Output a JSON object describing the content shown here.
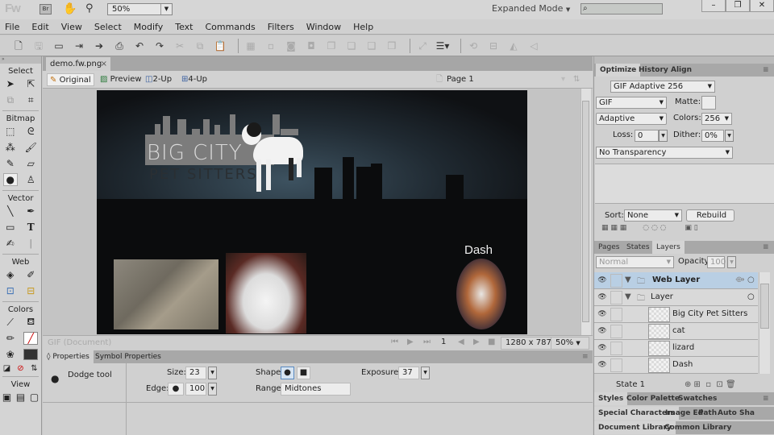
{
  "app": {
    "logo": "Fw",
    "bridge_label": "Br",
    "zoom_value": "50%",
    "workspace_mode": "Expanded Mode",
    "search_placeholder": "",
    "window_controls": {
      "minimize": "–",
      "restore": "❐",
      "close": "✕"
    }
  },
  "menu": [
    "File",
    "Edit",
    "View",
    "Select",
    "Modify",
    "Text",
    "Commands",
    "Filters",
    "Window",
    "Help"
  ],
  "toolbar": {
    "icons": [
      "new-document-icon",
      "save-icon",
      "open-icon",
      "import-icon",
      "export-icon",
      "print-icon",
      "undo-icon",
      "redo-icon",
      "cut-icon",
      "copy-icon",
      "paste-icon",
      "group-icon",
      "ungroup-icon",
      "join-icon",
      "split-icon",
      "bring-to-front-icon",
      "bring-forward-icon",
      "send-backward-icon",
      "send-to-back-icon",
      "distribute-icon",
      "align-icon",
      "rotate-icon",
      "flip-icon",
      "flip-horizontal-icon",
      "flip-vertical-icon"
    ]
  },
  "tools": {
    "sections": {
      "select": "Select",
      "bitmap": "Bitmap",
      "vector": "Vector",
      "web": "Web",
      "colors": "Colors",
      "view": "View"
    },
    "active_tool": "Dodge tool"
  },
  "document": {
    "tab_name": "demo.fw.png",
    "tab_close": "×",
    "views": [
      "Original",
      "Preview",
      "2-Up",
      "4-Up"
    ],
    "active_view": "Original",
    "page": "Page 1"
  },
  "artwork": {
    "logo_line1": "BIG CITY",
    "logo_line2": "PET SITTERS",
    "pet_label": "Dash",
    "images": [
      "lizard",
      "cat",
      "dog"
    ]
  },
  "status": {
    "doc_type": "GIF (Document)",
    "frame": "1",
    "dimensions": "1280 x 787",
    "zoom": "50%"
  },
  "properties": {
    "tabs": [
      "Properties",
      "Symbol Properties"
    ],
    "tool_name": "Dodge tool",
    "size_label": "Size:",
    "size_value": "23",
    "edge_label": "Edge:",
    "edge_value": "100",
    "shape_label": "Shape:",
    "range_label": "Range:",
    "range_value": "Midtones",
    "exposure_label": "Exposure:",
    "exposure_value": "37"
  },
  "optimize": {
    "tabs": [
      "Optimize",
      "History",
      "Align"
    ],
    "preset": "GIF Adaptive 256",
    "format": "GIF",
    "matte_label": "Matte:",
    "palette": "Adaptive",
    "colors_label": "Colors:",
    "colors_value": "256",
    "loss_label": "Loss:",
    "loss_value": "0",
    "dither_label": "Dither:",
    "dither_value": "0%",
    "transparency": "No Transparency",
    "sort_label": "Sort:",
    "sort_value": "None",
    "rebuild_label": "Rebuild"
  },
  "layers": {
    "tabs": [
      "Pages",
      "States",
      "Layers"
    ],
    "blend_mode": "Normal",
    "opacity_label": "Opacity",
    "opacity_value": "100",
    "rows": [
      {
        "name": "Web Layer",
        "type": "folder",
        "selected": true
      },
      {
        "name": "Layer",
        "type": "folder",
        "selected": false
      },
      {
        "name": "Big City Pet Sitters ...",
        "type": "object",
        "selected": false
      },
      {
        "name": "cat",
        "type": "object",
        "selected": false
      },
      {
        "name": "lizard",
        "type": "object",
        "selected": false
      },
      {
        "name": "Dash",
        "type": "text",
        "selected": false
      }
    ],
    "state": "State 1"
  },
  "bottom_panels": {
    "row1": [
      "Styles",
      "Color Palette",
      "Swatches"
    ],
    "row2": [
      "Special Characters",
      "Image Ed",
      "Path",
      "Auto Sha"
    ],
    "row3": [
      "Document Library",
      "Common Library"
    ]
  }
}
